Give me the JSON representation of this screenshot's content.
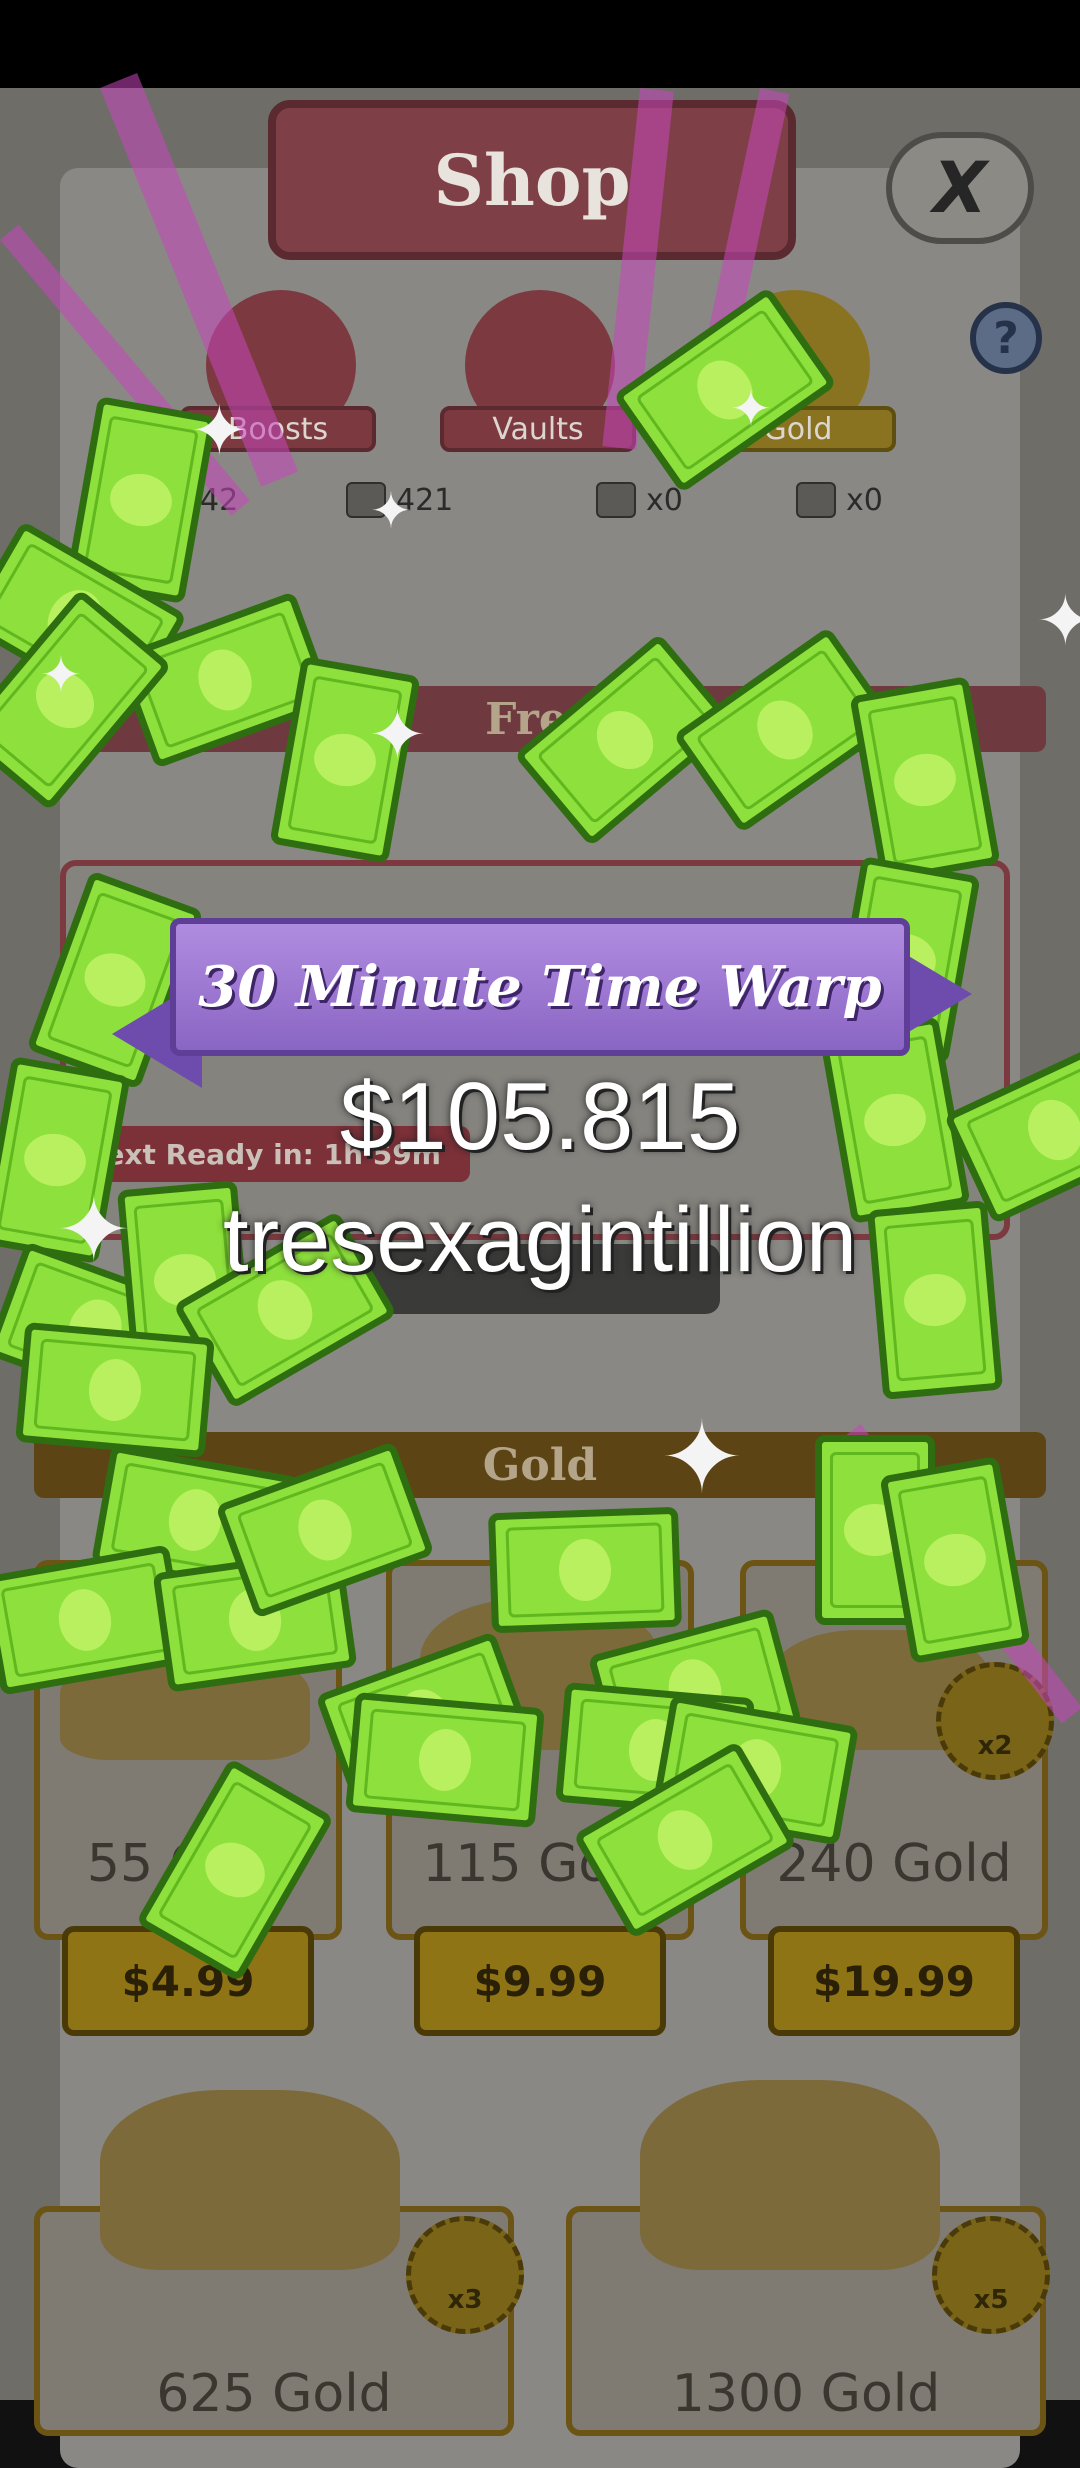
{
  "shop": {
    "title": "Shop",
    "close_label": "X",
    "help_label": "?",
    "tabs": [
      {
        "label": "Boosts"
      },
      {
        "label": "Vaults"
      },
      {
        "label": "Gold"
      }
    ],
    "counters": [
      {
        "value": "42",
        "icon": "boost-icon"
      },
      {
        "value": "421",
        "icon": "ticket-icon"
      },
      {
        "value": "x0",
        "icon": "money-bag-icon"
      },
      {
        "value": "x0",
        "icon": "mystery-box-icon"
      }
    ],
    "sections": {
      "free": "Free",
      "gold": "Gold"
    },
    "free_card": {
      "next_ready": "Next Ready in: 1h 59m"
    },
    "gold_items": [
      {
        "amount": "55 Gold",
        "price": "$4.99"
      },
      {
        "amount": "115 Gold",
        "price": "$9.99"
      },
      {
        "amount": "240 Gold",
        "price": "$19.99",
        "badge": "x2"
      },
      {
        "amount": "625 Gold",
        "badge": "x3"
      },
      {
        "amount": "1300 Gold",
        "badge": "x5"
      }
    ]
  },
  "reward": {
    "title": "30 Minute Time Warp",
    "amount": "$105.815",
    "unit": "tresexagintillion"
  },
  "colors": {
    "ribbon": "#9a78d4",
    "bill_green": "#8ee03c",
    "bill_border": "#2f6e10",
    "ray": "#c846be"
  }
}
